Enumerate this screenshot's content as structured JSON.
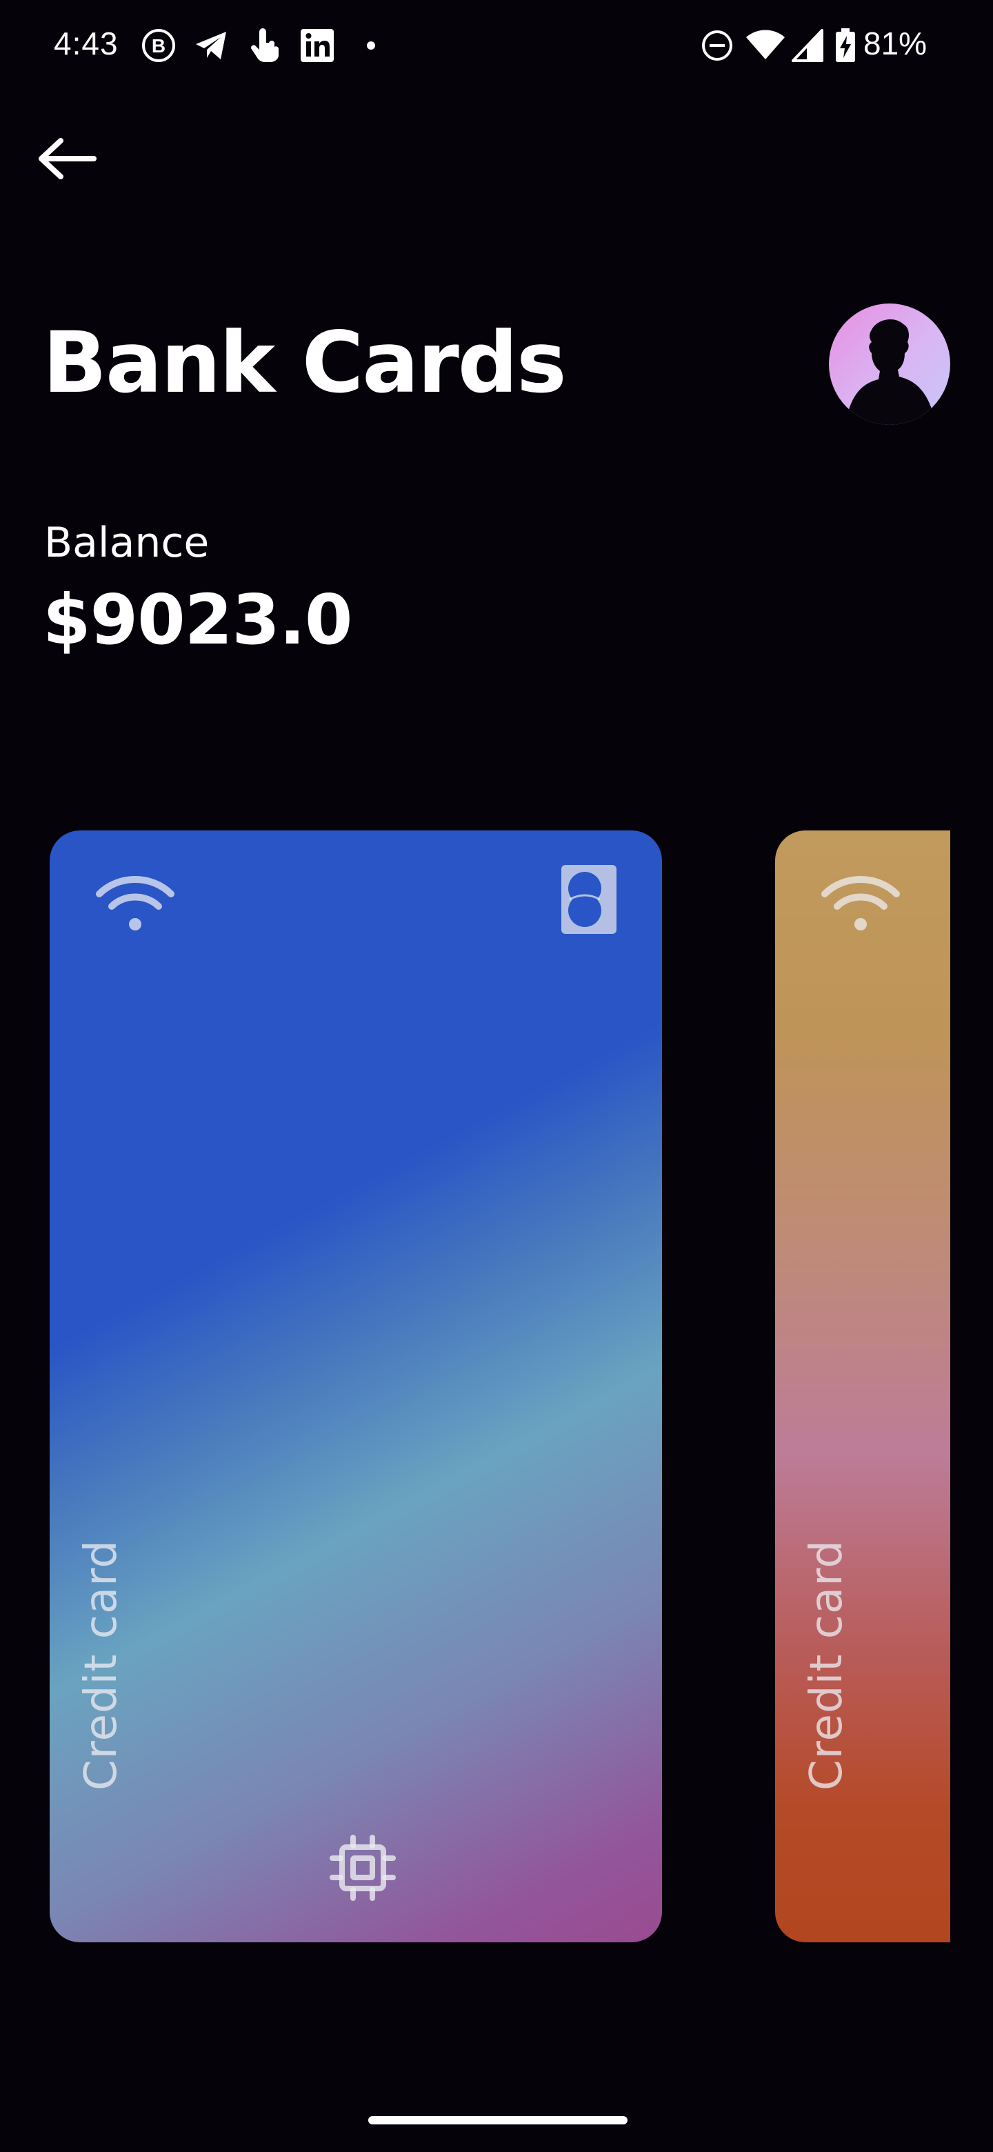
{
  "status_bar": {
    "time": "4:43",
    "battery_percent": "81%",
    "left_icons": [
      "b-circle-icon",
      "telegram-icon",
      "touch-hand-icon",
      "linkedin-icon",
      "dot-icon"
    ],
    "right_icons": [
      "do-not-disturb-icon",
      "wifi-icon",
      "signal-icon",
      "battery-charging-icon"
    ]
  },
  "header": {
    "back_icon": "arrow-left-icon",
    "title": "Bank Cards",
    "avatar_icon": "profile-avatar"
  },
  "balance": {
    "label": "Balance",
    "value": "$9023.0"
  },
  "cards": [
    {
      "label": "Credit card",
      "brand": "mastercard",
      "icons": [
        "contactless-icon",
        "mastercard-icon",
        "chip-icon"
      ],
      "colors": [
        "#2955c6",
        "#6aa3c0",
        "#9a4b90"
      ]
    },
    {
      "label": "Credit card",
      "icons": [
        "contactless-icon"
      ],
      "colors": [
        "#c19a5e",
        "#bd7c98",
        "#b24620"
      ]
    }
  ],
  "colors": {
    "background": "#050309",
    "text": "#ffffff"
  }
}
